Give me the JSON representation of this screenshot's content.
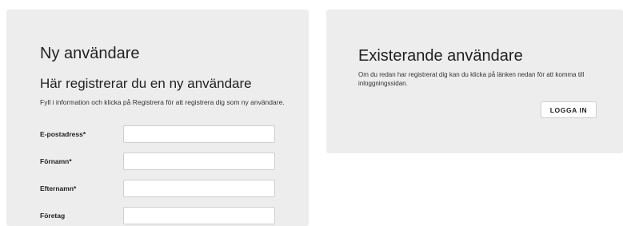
{
  "new_user": {
    "title": "Ny användare",
    "subtitle": "Här registrerar du en ny användare",
    "info": "Fyll i information och klicka på Registrera för att registrera dig som ny användare.",
    "fields": [
      {
        "label": "E-postadress*",
        "value": ""
      },
      {
        "label": "Förnamn*",
        "value": ""
      },
      {
        "label": "Efternamn*",
        "value": ""
      },
      {
        "label": "Företag",
        "value": ""
      }
    ]
  },
  "existing_user": {
    "title": "Existerande användare",
    "description": "Om du redan har registrerat dig kan du klicka på länken nedan för att komma till inloggningssidan.",
    "login_label": "LOGGA IN"
  }
}
